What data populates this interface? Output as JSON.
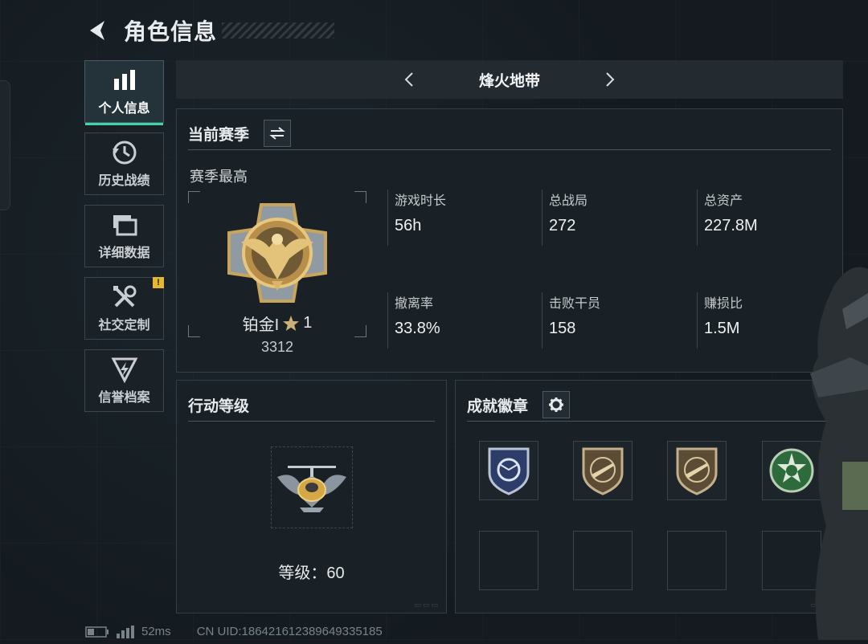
{
  "header": {
    "title": "角色信息"
  },
  "nav": {
    "items": [
      {
        "label": "个人信息",
        "icon": "bar-chart-icon",
        "active": true
      },
      {
        "label": "历史战绩",
        "icon": "history-clock-icon",
        "active": false
      },
      {
        "label": "详细数据",
        "icon": "folders-icon",
        "active": false
      },
      {
        "label": "社交定制",
        "icon": "tools-icon",
        "active": false,
        "badge": "!"
      },
      {
        "label": "信誉档案",
        "icon": "lightning-shield-icon",
        "active": false
      }
    ]
  },
  "mode": {
    "name": "烽火地带"
  },
  "season": {
    "title": "当前赛季",
    "subtitle": "赛季最高",
    "rank_name": "铂金I",
    "rank_stars": "1",
    "rank_score": "3312",
    "stats": [
      {
        "label": "游戏时长",
        "value": "56h"
      },
      {
        "label": "总战局",
        "value": "272"
      },
      {
        "label": "总资产",
        "value": "227.8M"
      },
      {
        "label": "撤离率",
        "value": "33.8%"
      },
      {
        "label": "击败干员",
        "value": "158"
      },
      {
        "label": "赚损比",
        "value": "1.5M"
      }
    ]
  },
  "level": {
    "title": "行动等级",
    "text": "等级：60"
  },
  "badges": {
    "title": "成就徽章",
    "slots": [
      "blue-shield-badge-icon",
      "rifle-shield-badge-icon",
      "rifle-shield-badge-icon",
      "green-skull-badge-icon",
      "",
      "",
      "",
      ""
    ]
  },
  "footer": {
    "ping": "52ms",
    "uid": "CN UID:1864216123896493351​85"
  },
  "colors": {
    "accent": "#3fd6a6",
    "warning": "#e6b830",
    "background": "#141a1f"
  }
}
